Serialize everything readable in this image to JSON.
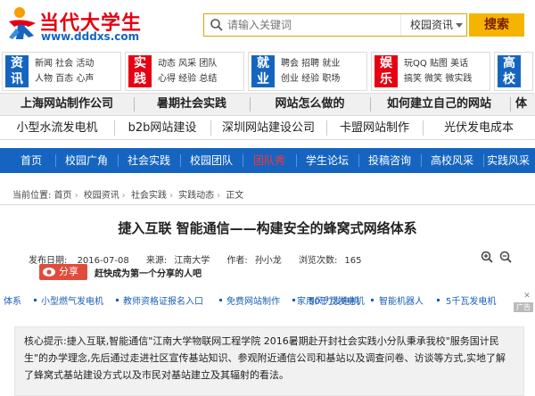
{
  "header": {
    "site_title": "当代大学生",
    "site_url": "www.dddxs.com",
    "search_placeholder": "请输入关键词",
    "search_category": "校园资讯",
    "search_button": "搜索"
  },
  "channels": [
    {
      "big": "资讯",
      "color": "#1565c0",
      "links": [
        "新闻 社会 活动",
        "人物 百态 心声"
      ]
    },
    {
      "big": "实践",
      "color": "#e60012",
      "links": [
        "动态 风采 团队",
        "心得 经验 总结"
      ]
    },
    {
      "big": "就业",
      "color": "#1565c0",
      "links": [
        "聘会 招聘 就业",
        "创业 经验 职场"
      ]
    },
    {
      "big": "娱乐",
      "color": "#e60012",
      "links": [
        "玩QQ 贴图 美话",
        "搞笑 微笑 微实践"
      ]
    },
    {
      "big": "高校",
      "color": "#1565c0",
      "links": [
        "",
        ""
      ]
    }
  ],
  "banner_row1": [
    "上海网站制作公司",
    "暑期社会实践",
    "网站怎么做的",
    "如何建立自己的网站",
    "体"
  ],
  "banner_row2": [
    "小型水流发电机",
    "b2b网站建设",
    "深圳网站建设公司",
    "卡盟网站制作",
    "光伏发电成本"
  ],
  "main_nav": [
    "首页",
    "校园广角",
    "社会实践",
    "校园团队",
    "团队秀",
    "学生论坛",
    "投稿咨询",
    "高校风采",
    "实践风采"
  ],
  "main_nav_active_index": 4,
  "breadcrumb": {
    "label": "当前位置:",
    "items": [
      "首页",
      "校园资讯",
      "社会实践",
      "实践动态",
      "正文"
    ]
  },
  "article": {
    "title": "捷入互联  智能通信——构建安全的蜂窝式网络体系",
    "publish_label": "发布日期:",
    "publish_date": "2016-07-08",
    "source_label": "来源:",
    "source": "江南大学",
    "author_label": "作者:",
    "author": "孙小龙",
    "views_label": "浏览次数:",
    "views": "165",
    "share_label": "分享",
    "share_prompt": "赶快成为第一个分享的人吧",
    "summary": "核心提示:捷入互联,智能通信\"江南大学物联网工程学院 2016暑期赴开封社会实践小分队秉承我校\"服务国计民生\"的办学理念,先后通过走进社区宣传基站知识、参观附近通信公司和基站以及调查问卷、访谈等方式,实地了解了蜂窝式基站建设方式以及市民对基站建立及其辐射的看法。"
  },
  "ad_links": [
    "体系",
    "小型燃气发电机",
    "教师资格证报名入口",
    "免费网站制作",
    "家用风力发电机",
    "50千瓦发电机",
    "智能机器人",
    "5千瓦发电机"
  ],
  "ad_badge": "广告",
  "colors": {
    "brand_blue": "#1565c0",
    "brand_red": "#e60012",
    "search_gold": "#f5b400"
  }
}
